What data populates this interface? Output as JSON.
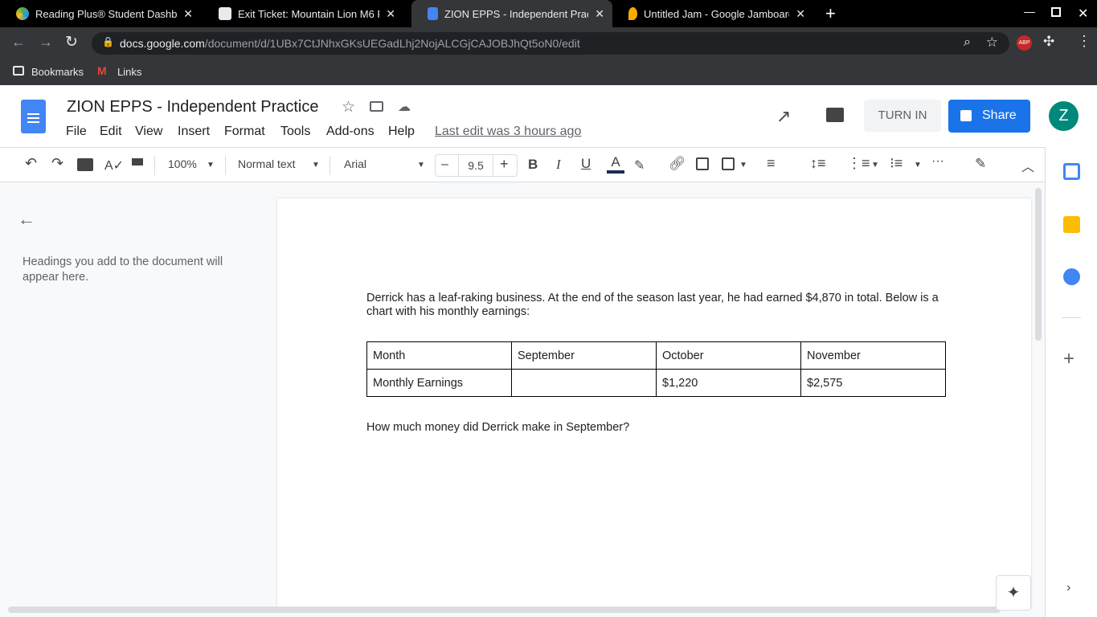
{
  "browser": {
    "tabs": [
      {
        "title": "Reading Plus® Student Dashboa",
        "icon": "reading-plus-icon",
        "active": false
      },
      {
        "title": "Exit Ticket: Mountain Lion M6 Fi",
        "icon": "classroom-icon",
        "active": false
      },
      {
        "title": "ZION EPPS - Independent Practic",
        "icon": "docs-icon",
        "active": true
      },
      {
        "title": "Untitled Jam - Google Jamboard",
        "icon": "jamboard-icon",
        "active": false
      }
    ],
    "url_domain": "docs.google.com",
    "url_path": "/document/d/1UBx7CtJNhxGKsUEGadLhj2NojALCGjCAJOBJhQt5oN0/edit",
    "bookmarks": [
      "Bookmarks",
      "Links"
    ],
    "abp": "ABP"
  },
  "doc": {
    "title": "ZION EPPS - Independent Practice",
    "menus": [
      "File",
      "Edit",
      "View",
      "Insert",
      "Format",
      "Tools",
      "Add-ons",
      "Help"
    ],
    "last_edit": "Last edit was 3 hours ago",
    "turn_in": "TURN IN",
    "share": "Share",
    "avatar": "Z"
  },
  "toolbar": {
    "zoom": "100%",
    "style": "Normal text",
    "font": "Arial",
    "size": "9.5",
    "minus": "–",
    "plus": "+"
  },
  "outline": {
    "hint": "Headings you add to the document will appear here."
  },
  "content": {
    "paragraph": "Derrick has a leaf-raking business. At the end of the season last year, he had earned $4,870 in total. Below is a chart with his monthly earnings:",
    "table": [
      [
        "Month",
        "September",
        "October",
        "November"
      ],
      [
        "Monthly Earnings",
        "",
        "$1,220",
        "$2,575"
      ]
    ],
    "question": "How much money did Derrick make in September?"
  },
  "colors": {
    "accent": "#1a73e8",
    "avatar": "#00897b"
  }
}
